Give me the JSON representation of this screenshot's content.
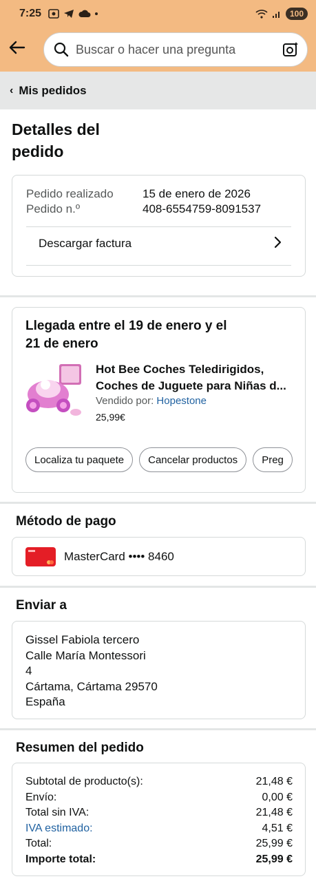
{
  "status_bar": {
    "time": "7:25",
    "battery": "100"
  },
  "search": {
    "placeholder": "Buscar o hacer una pregunta"
  },
  "breadcrumb": {
    "label": "Mis pedidos"
  },
  "page": {
    "title": "Detalles del pedido"
  },
  "order_info": {
    "placed_label": "Pedido realizado",
    "placed_value": "15 de enero de 2026",
    "number_label": "Pedido n.º",
    "number_value": "408-6554759-8091537",
    "invoice_label": "Descargar factura"
  },
  "shipment": {
    "arrival_line1": "Llegada entre el 19 de enero y el",
    "arrival_line2": "21 de enero",
    "product_title_line1": "Hot Bee Coches Teledirigidos,",
    "product_title_line2": "Coches de Juguete para Niñas d...",
    "sold_by_label": "Vendido por:",
    "seller": "Hopestone",
    "price": "25,99€",
    "actions": [
      "Localiza tu paquete",
      "Cancelar productos",
      "Preg"
    ]
  },
  "payment": {
    "heading": "Método de pago",
    "card_text": "MasterCard •••• 8460",
    "card_color": "#e41e26"
  },
  "shipping": {
    "heading": "Enviar a",
    "lines": [
      "Gissel Fabiola tercero",
      "Calle María Montessori",
      "4",
      "Cártama, Cártama 29570",
      "España"
    ]
  },
  "summary": {
    "heading": "Resumen del pedido",
    "rows": [
      {
        "label": "Subtotal de producto(s):",
        "value": "21,48 €"
      },
      {
        "label": "Envío:",
        "value": "0,00 €"
      },
      {
        "label": "Total sin IVA:",
        "value": "21,48 €"
      },
      {
        "label": "IVA estimado:",
        "value": "4,51 €"
      },
      {
        "label": "Total:",
        "value": "25,99 €"
      },
      {
        "label": "Importe total:",
        "value": "25,99 €"
      }
    ]
  },
  "colors": {
    "header": "#f3ba82",
    "link": "#2162a1"
  },
  "icons": [
    "back-arrow-icon",
    "search-icon",
    "camera-icon",
    "chevron-left-icon",
    "chevron-right-icon",
    "mastercard-icon"
  ]
}
